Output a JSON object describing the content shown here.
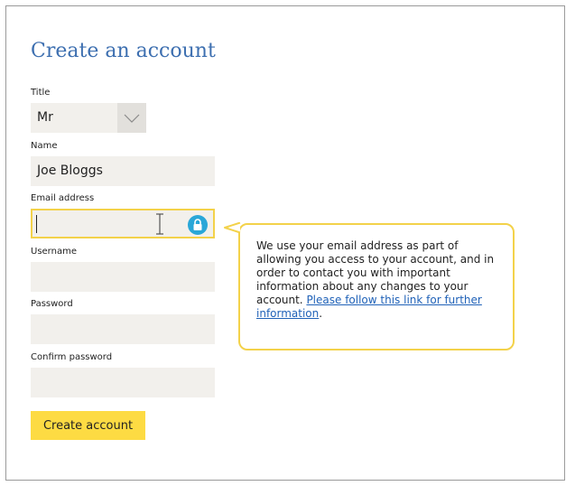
{
  "page": {
    "title": "Create an account"
  },
  "form": {
    "title_field": {
      "label": "Title",
      "value": "Mr"
    },
    "name_field": {
      "label": "Name",
      "value": "Joe Bloggs"
    },
    "email_field": {
      "label": "Email address",
      "value": ""
    },
    "username_field": {
      "label": "Username",
      "value": ""
    },
    "password_field": {
      "label": "Password",
      "value": ""
    },
    "confirm_password_field": {
      "label": "Confirm password",
      "value": ""
    },
    "submit_label": "Create account"
  },
  "tooltip": {
    "text": "We use your email address as part of allowing you access to your account, and in order to contact you with important information about any changes to your account. ",
    "link_text": "Please follow this link for further information",
    "trailing_text": "."
  },
  "icons": {
    "select_arrow": "chevron-down-icon",
    "text_cursor": "text-cursor-icon",
    "password_manager": "lock-icon"
  },
  "colors": {
    "heading": "#3d6fb0",
    "field_background": "#f2f0ec",
    "focus_outline": "#f3d24a",
    "primary_button": "#fddb43",
    "link": "#2062b8",
    "lock_badge": "#2aa7d8"
  }
}
